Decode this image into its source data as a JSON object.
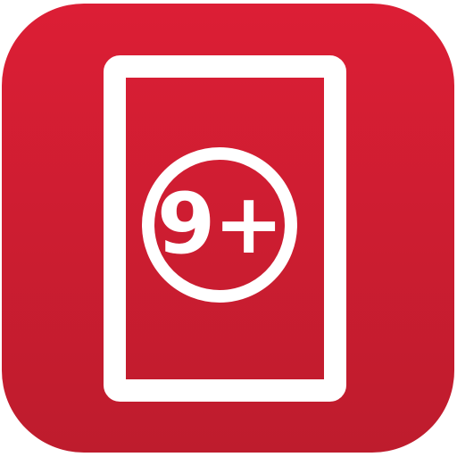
{
  "app_icon": {
    "name": "age-rating-app-icon",
    "badge": {
      "label": "9+"
    },
    "colors": {
      "background_top": "#dc1e35",
      "background_bottom": "#be1c2d",
      "foreground": "#ffffff"
    }
  }
}
